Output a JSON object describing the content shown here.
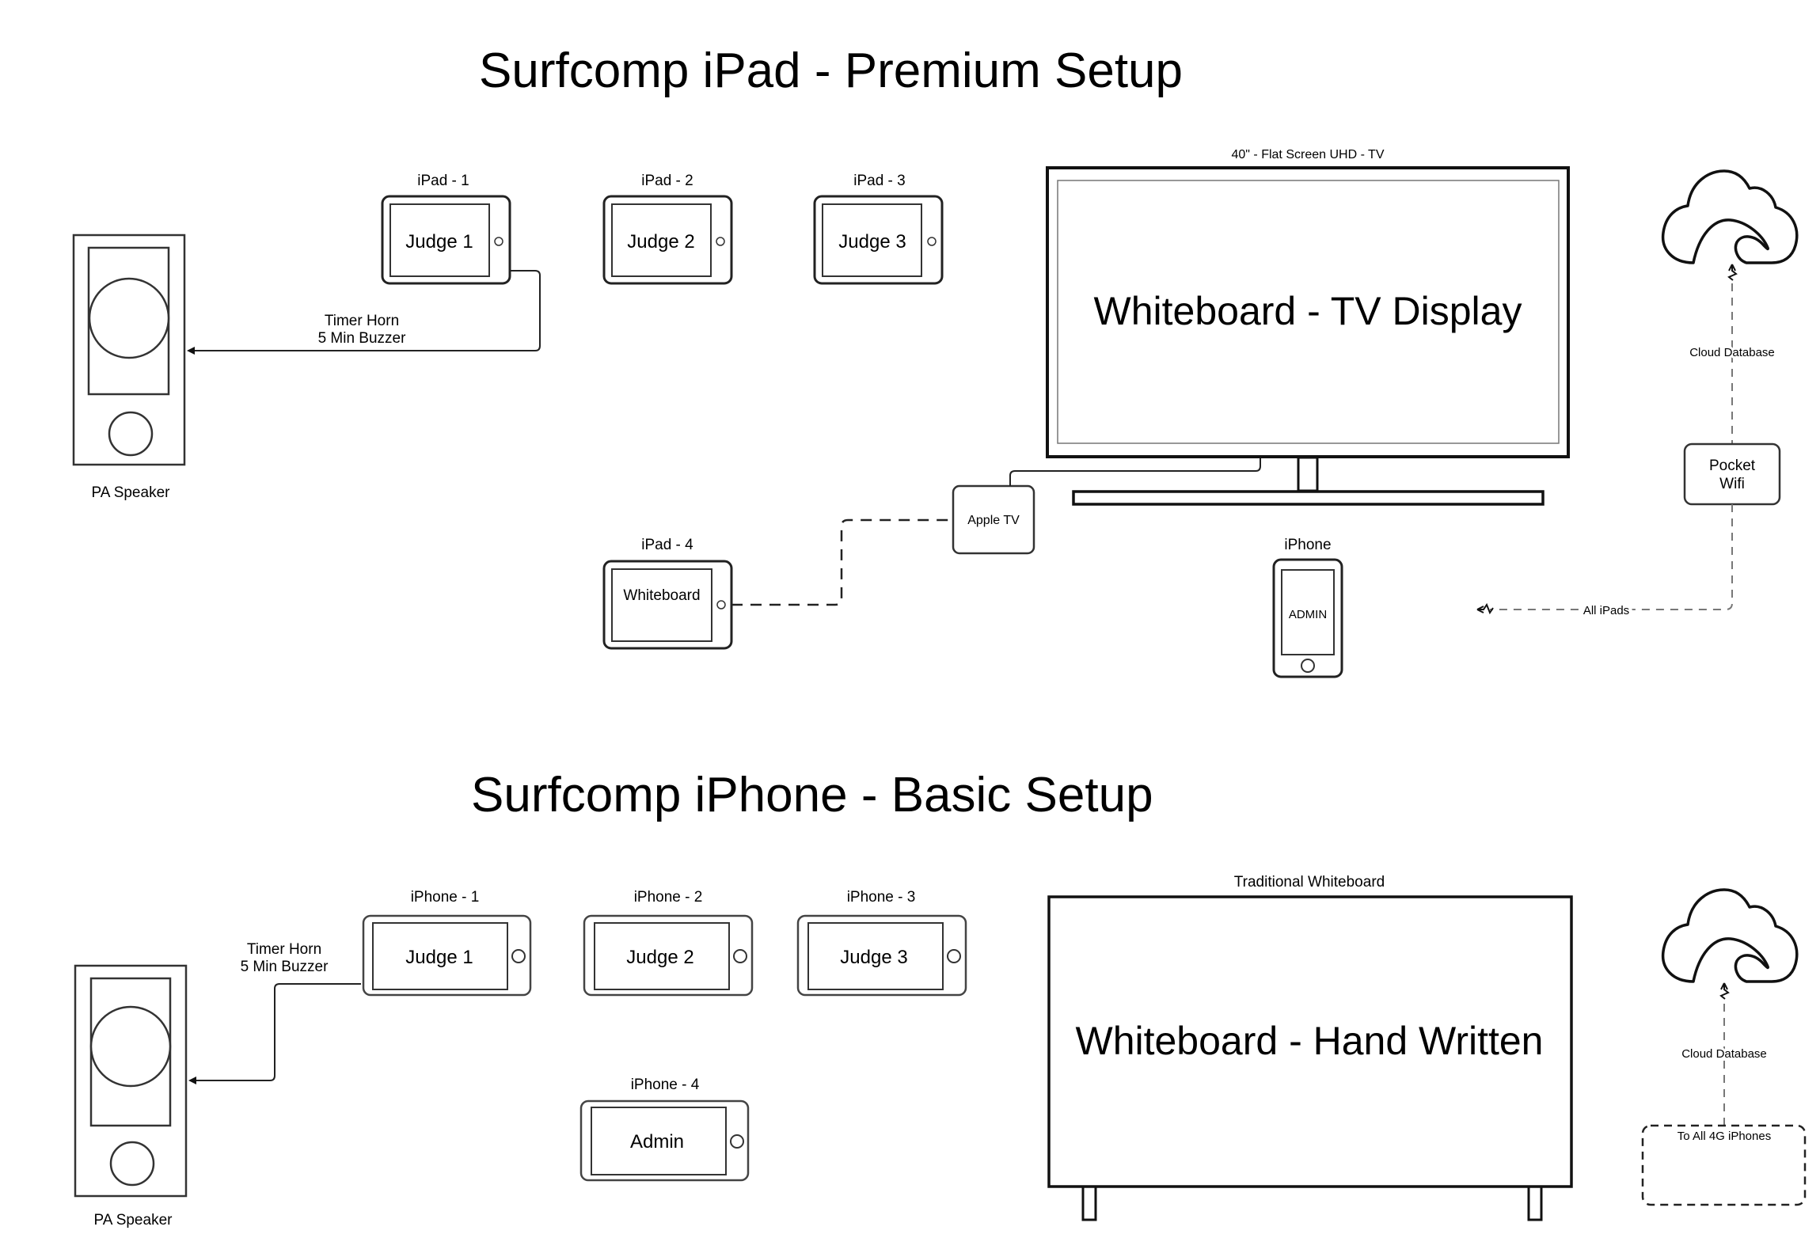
{
  "premium": {
    "title": "Surfcomp iPad - Premium Setup",
    "speaker_label": "PA Speaker",
    "timer_line1": "Timer Horn",
    "timer_line2": "5 Min Buzzer",
    "ipads": [
      {
        "label": "iPad - 1",
        "screen": "Judge 1"
      },
      {
        "label": "iPad - 2",
        "screen": "Judge 2"
      },
      {
        "label": "iPad - 3",
        "screen": "Judge 3"
      },
      {
        "label": "iPad - 4",
        "screen": "Whiteboard"
      }
    ],
    "tv_label": "40\" - Flat Screen UHD - TV",
    "tv_screen": "Whiteboard - TV Display",
    "apple_tv": "Apple TV",
    "iphone_label": "iPhone",
    "iphone_screen": "ADMIN",
    "cloud_label": "Cloud Database",
    "wifi_line1": "Pocket",
    "wifi_line2": "Wifi",
    "all_ipads": "All iPads"
  },
  "basic": {
    "title": "Surfcomp iPhone - Basic Setup",
    "speaker_label": "PA Speaker",
    "timer_line1": "Timer Horn",
    "timer_line2": "5 Min Buzzer",
    "iphones": [
      {
        "label": "iPhone - 1",
        "screen": "Judge 1"
      },
      {
        "label": "iPhone - 2",
        "screen": "Judge 2"
      },
      {
        "label": "iPhone - 3",
        "screen": "Judge 3"
      },
      {
        "label": "iPhone - 4",
        "screen": "Admin"
      }
    ],
    "board_label": "Traditional Whiteboard",
    "board_text": "Whiteboard - Hand Written",
    "cloud_label": "Cloud Database",
    "all_iphones": "To All 4G iPhones"
  }
}
